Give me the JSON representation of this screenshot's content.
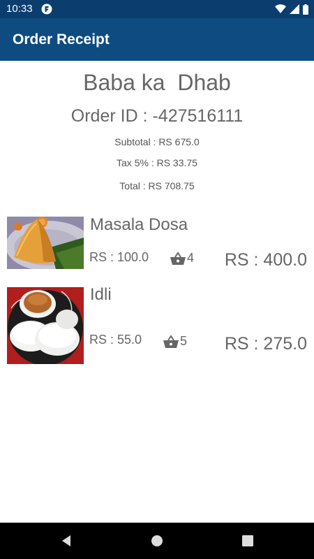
{
  "status_bar": {
    "time": "10:33",
    "app_icon": "app-notification-icon",
    "icons": [
      "wifi-icon",
      "signal-icon",
      "battery-icon"
    ]
  },
  "app_bar": {
    "title": "Order Receipt"
  },
  "receipt": {
    "restaurant_name": "Baba ka  Dhab",
    "order_id": "Order ID : -427516111",
    "subtotal": "Subtotal : RS 675.0",
    "tax": "Tax 5% : RS 33.75",
    "total": "Total : RS 708.75"
  },
  "items": [
    {
      "name": "Masala Dosa",
      "price": "RS : 100.0",
      "quantity": "4",
      "line_total": "RS : 400.0",
      "image": "masala-dosa-photo"
    },
    {
      "name": "Idli",
      "price": "RS : 55.0",
      "quantity": "5",
      "line_total": "RS : 275.0",
      "image": "idli-photo"
    }
  ],
  "nav_bar": {
    "buttons": [
      "back-icon",
      "home-icon",
      "recents-icon"
    ]
  },
  "colors": {
    "status_bar": "#0b3d6e",
    "app_bar": "#0e4b80",
    "text": "#666666"
  }
}
